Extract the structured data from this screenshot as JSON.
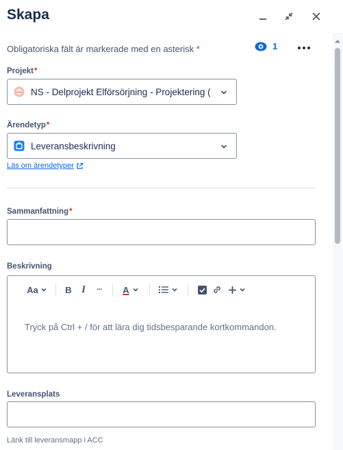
{
  "header": {
    "title": "Skapa",
    "minimize_icon": "minimize-icon",
    "collapse_icon": "collapse-icon",
    "close_icon": "close-icon"
  },
  "form": {
    "required_note": "Obligatoriska fält är markerade med en asterisk",
    "required_marker": "*",
    "watch_count": "1",
    "project": {
      "label": "Projekt",
      "value": "NS - Delprojekt Elförsörjning - Projektering ("
    },
    "issue_type": {
      "label": "Ärendetyp",
      "value": "Leveransbeskrivning",
      "help_link": "Läs om ärendetyper"
    },
    "summary": {
      "label": "Sammanfattning",
      "value": ""
    },
    "description": {
      "label": "Beskrivning",
      "placeholder": "Tryck på Ctrl + / för att lära dig tidsbesparande kortkommandon.",
      "toolbar": {
        "text_style": "Aa",
        "bold": "B",
        "italic": "I",
        "more": "···",
        "text_color": "A"
      }
    },
    "delivery_place": {
      "label": "Leveransplats",
      "value": "",
      "hint": "Länk till leveransmapp i ACC"
    }
  },
  "colors": {
    "accent": "#0c66e4",
    "required": "#c9372c",
    "text": "#172b4d",
    "border": "#8590a2"
  }
}
